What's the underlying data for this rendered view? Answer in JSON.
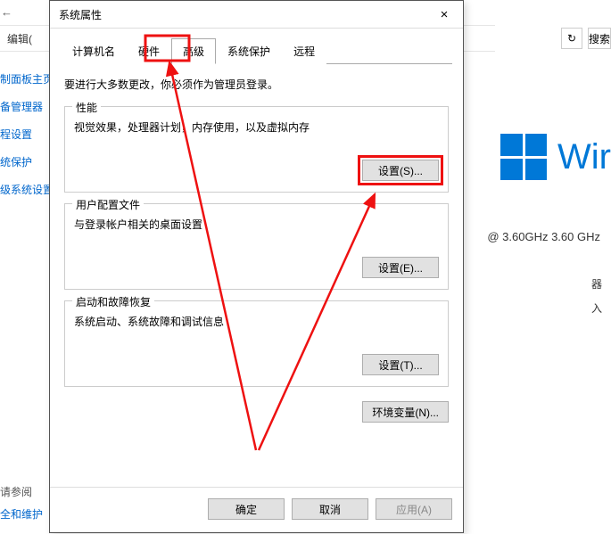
{
  "bg": {
    "arrow": "←",
    "edit": "编辑(",
    "sidebar": [
      "制面板主页",
      "备管理器",
      "程设置",
      "统保护",
      "级系统设置"
    ],
    "footer": [
      "请参阅",
      "全和维护"
    ],
    "refresh": "↻",
    "search_placeholder": "搜索",
    "win_text": "Wir",
    "cpu": "@ 3.60GHz   3.60 GHz",
    "misc": [
      "器",
      "入"
    ]
  },
  "dialog": {
    "title": "系统属性",
    "close": "×",
    "tabs": [
      "计算机名",
      "硬件",
      "高级",
      "系统保护",
      "远程"
    ],
    "active_tab": 2,
    "instruction": "要进行大多数更改，你必须作为管理员登录。",
    "groups": {
      "perf": {
        "title": "性能",
        "text": "视觉效果，处理器计划，内存使用，以及虚拟内存",
        "btn": "设置(S)..."
      },
      "user": {
        "title": "用户配置文件",
        "text": "与登录帐户相关的桌面设置",
        "btn": "设置(E)..."
      },
      "startup": {
        "title": "启动和故障恢复",
        "text": "系统启动、系统故障和调试信息",
        "btn": "设置(T)..."
      }
    },
    "env_btn": "环境变量(N)...",
    "buttons": {
      "ok": "确定",
      "cancel": "取消",
      "apply": "应用(A)"
    }
  }
}
